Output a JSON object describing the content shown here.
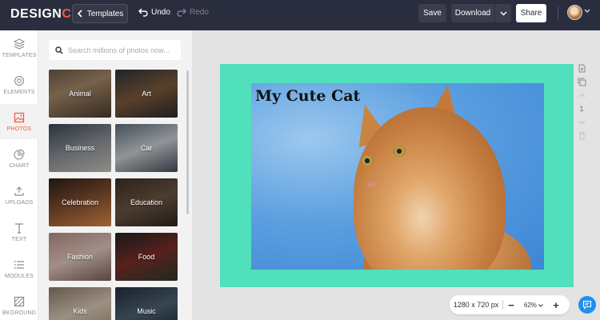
{
  "app": {
    "logo_part1": "DESIGN",
    "logo_part2": "CAP"
  },
  "toolbar": {
    "templates_label": "Templates",
    "undo_label": "Undo",
    "redo_label": "Redo",
    "save_label": "Save",
    "download_label": "Download",
    "share_label": "Share"
  },
  "sidebar": {
    "items": [
      {
        "label": "TEMPLATES",
        "icon": "layers-icon"
      },
      {
        "label": "ELEMENTS",
        "icon": "elements-icon"
      },
      {
        "label": "PHOTOS",
        "icon": "photo-icon"
      },
      {
        "label": "CHART",
        "icon": "pie-chart-icon"
      },
      {
        "label": "UPLOADS",
        "icon": "upload-icon"
      },
      {
        "label": "TEXT",
        "icon": "text-icon"
      },
      {
        "label": "MODULES",
        "icon": "list-icon"
      },
      {
        "label": "BKGROUND",
        "icon": "background-icon"
      }
    ],
    "active": "PHOTOS"
  },
  "photos_panel": {
    "search_placeholder": "Search millions of photos now...",
    "categories": [
      "Animal",
      "Art",
      "Business",
      "Car",
      "Celebration",
      "Education",
      "Fashion",
      "Food",
      "Kids",
      "Music"
    ]
  },
  "canvas": {
    "title_text": "My Cute Cat",
    "background_color": "#50e0bb",
    "page_number": "1"
  },
  "zoom": {
    "canvas_size": "1280 x 720 px",
    "zoom_level": "62%",
    "zoom_out": "−",
    "zoom_in": "+"
  },
  "colors": {
    "topbar": "#2a2d3d",
    "accent": "#ef5a3f",
    "chat": "#1f8ff0"
  }
}
